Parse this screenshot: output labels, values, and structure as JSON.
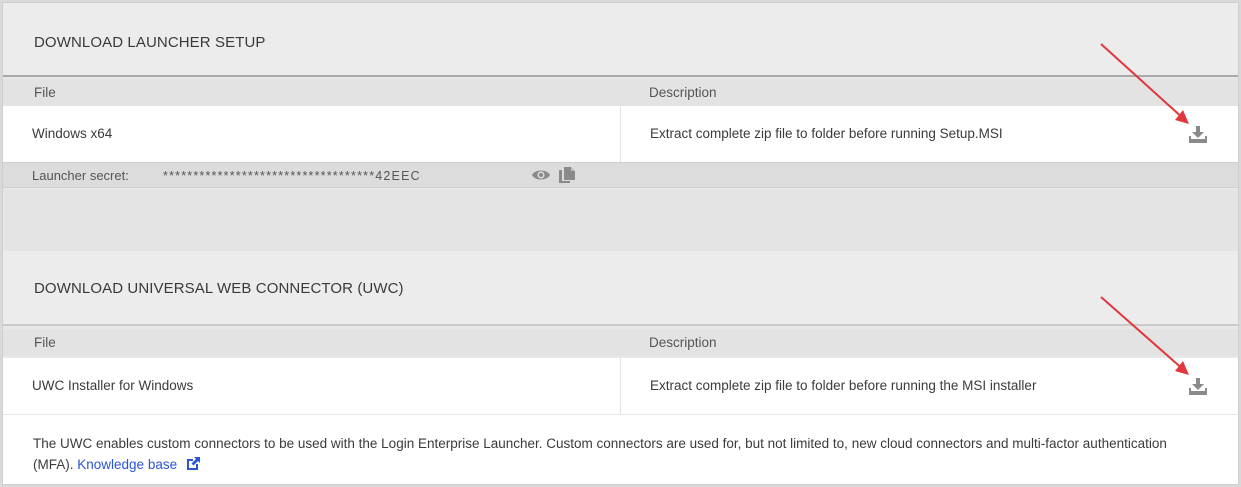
{
  "section1": {
    "title": "DOWNLOAD LAUNCHER SETUP",
    "columns": {
      "file": "File",
      "description": "Description"
    },
    "rows": [
      {
        "file": "Windows x64",
        "description": "Extract complete zip file to folder before running Setup.MSI",
        "action_icon": "download-icon"
      }
    ],
    "secret": {
      "label": "Launcher secret:",
      "value": "***********************************42EEC",
      "reveal_icon": "eye-icon",
      "copy_icon": "copy-icon"
    }
  },
  "section2": {
    "title": "DOWNLOAD UNIVERSAL WEB CONNECTOR (UWC)",
    "columns": {
      "file": "File",
      "description": "Description"
    },
    "rows": [
      {
        "file": "UWC Installer for Windows",
        "description": "Extract complete zip file to folder before running the MSI installer",
        "action_icon": "download-icon"
      }
    ],
    "info": {
      "text": "The UWC enables custom connectors to be used with the Login Enterprise Launcher. Custom connectors are used for, but not limited to, new cloud connectors and multi-factor authentication (MFA).",
      "link_label": "Knowledge base",
      "link_icon": "external-link-icon"
    }
  },
  "colors": {
    "annotation_arrow": "#e0383e",
    "link": "#2a55d5",
    "icon_gray": "#8a8a8a"
  }
}
